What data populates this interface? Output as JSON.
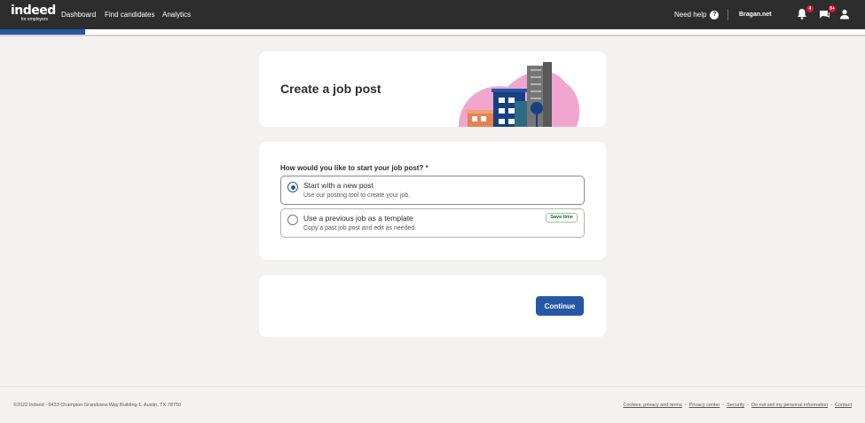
{
  "header": {
    "logo_text": "indeed",
    "logo_sub": "for employers",
    "nav": [
      "Dashboard",
      "Find candidates",
      "Analytics"
    ],
    "help_label": "Need help",
    "help_icon": "question-circle-icon",
    "account_name": "Bragan.net",
    "notifications_badge": "4",
    "messages_badge": "9+"
  },
  "progress": {
    "fraction": 0.098
  },
  "page": {
    "title": "Create a job post"
  },
  "form": {
    "question": "How would you like to start your job post?",
    "required_mark": "*",
    "options": [
      {
        "title": "Start with a new post",
        "description": "Use our posting tool to create your job.",
        "selected": true
      },
      {
        "title": "Use a previous job as a template",
        "description": "Copy a past job post and edit as needed.",
        "selected": false,
        "tag": "Save time"
      }
    ]
  },
  "actions": {
    "continue_label": "Continue"
  },
  "footer": {
    "copyright": "©2022 Indeed - 6433 Champion Grandview Way Building 1, Austin, TX 78750",
    "links": [
      "Cookies, privacy and terms",
      "Privacy center",
      "Security",
      "Do not sell my personal information",
      "Contact"
    ],
    "separator": "-"
  },
  "colors": {
    "nav_bg": "#2d2d2d",
    "accent": "#2557a7",
    "page_bg": "#f3f2f1"
  }
}
